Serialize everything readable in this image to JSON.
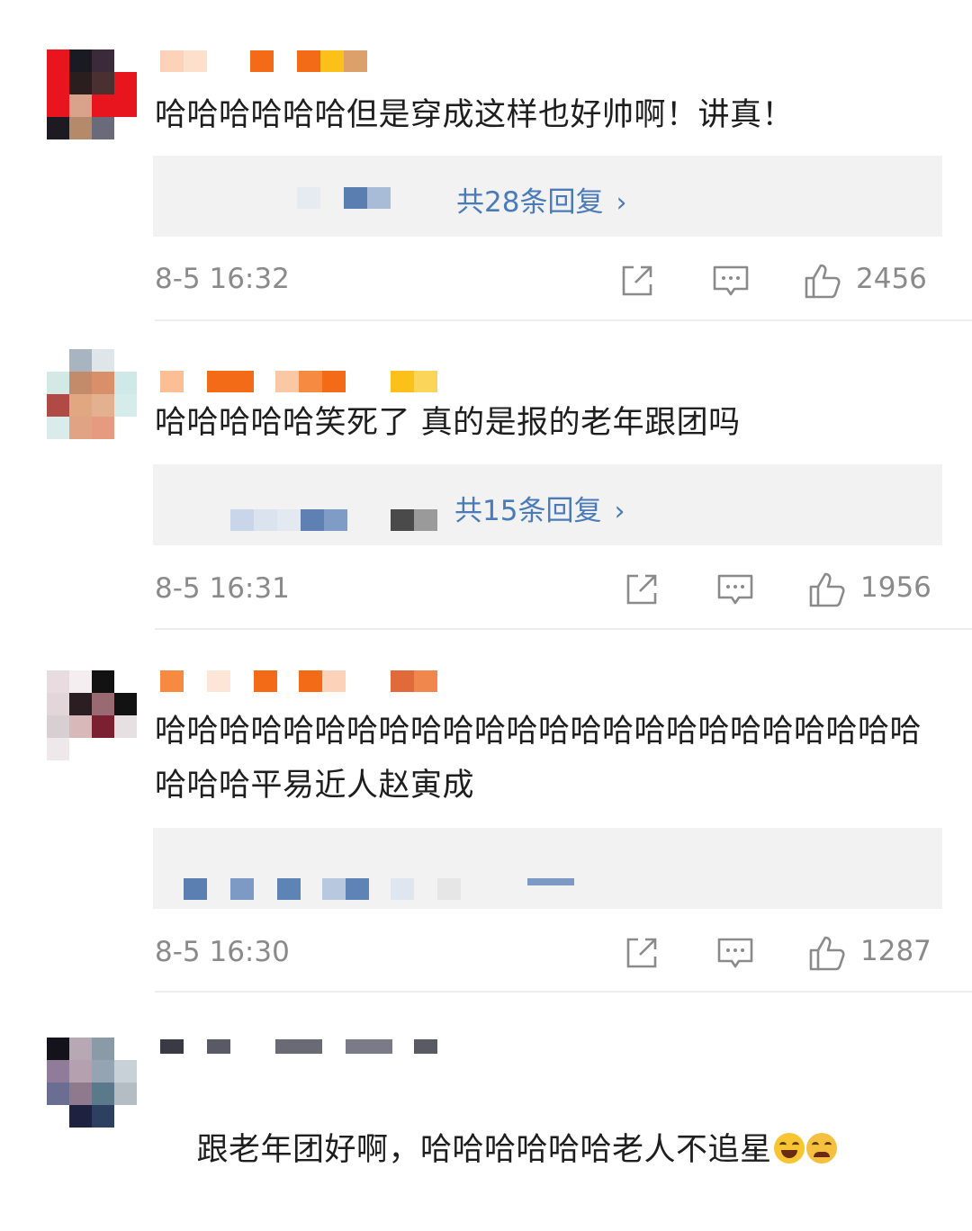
{
  "comments": [
    {
      "text": "哈哈哈哈哈哈但是穿成这样也好帅啊！讲真！",
      "reply_label": "共28条回复",
      "time": "8-5 16:32",
      "likes": "2456"
    },
    {
      "text": "哈哈哈哈哈笑死了 真的是报的老年跟团吗",
      "reply_label": "共15条回复",
      "time": "8-5 16:31",
      "likes": "1956"
    },
    {
      "text": "哈哈哈哈哈哈哈哈哈哈哈哈哈哈哈哈哈哈哈哈哈哈哈哈哈哈哈平易近人赵寅成",
      "time": "8-5 16:30",
      "likes": "1287"
    },
    {
      "text": "跟老年团好啊，哈哈哈哈哈哈老人不追星",
      "emojis": [
        "laughing-tears",
        "crying"
      ]
    }
  ],
  "icons": {
    "share": "share-icon",
    "comment": "comment-icon",
    "like": "thumbs-up-icon"
  },
  "colors": {
    "link": "#4a7ab8",
    "meta": "#8a8a8a",
    "reply_bg": "#f2f2f2"
  }
}
